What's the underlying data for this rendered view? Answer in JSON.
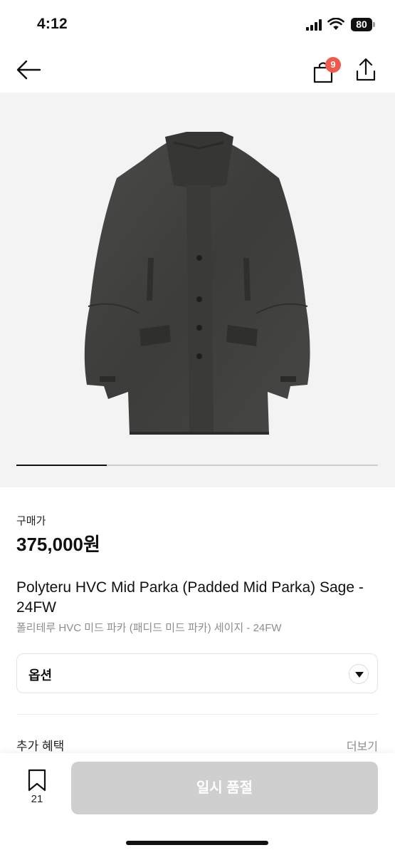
{
  "status_bar": {
    "time": "4:12",
    "battery": "80",
    "icons": [
      "signal-icon",
      "wifi-icon",
      "battery-icon"
    ]
  },
  "header": {
    "back_icon": "arrow-left-icon",
    "bag_icon": "shopping-bag-icon",
    "bag_badge": "9",
    "share_icon": "share-icon",
    "badge_color": "#ef5a4d"
  },
  "gallery": {
    "image": "dark grey padded mid parka",
    "progress": 0.25
  },
  "product": {
    "price_label": "구매가",
    "price": "375,000원",
    "title": "Polyteru HVC Mid Parka (Padded Mid Parka) Sage - 24FW",
    "subtitle": "폴리테루 HVC 미드 파카 (패디드 미드 파카) 세이지 - 24FW"
  },
  "options": {
    "label": "옵션",
    "icon": "chevron-down-icon"
  },
  "benefits": {
    "label": "추가 혜택",
    "more": "더보기"
  },
  "bottom": {
    "wish_icon": "bookmark-icon",
    "wish_count": "21",
    "button_label": "일시 품절",
    "button_color": "#cfcfcf"
  }
}
